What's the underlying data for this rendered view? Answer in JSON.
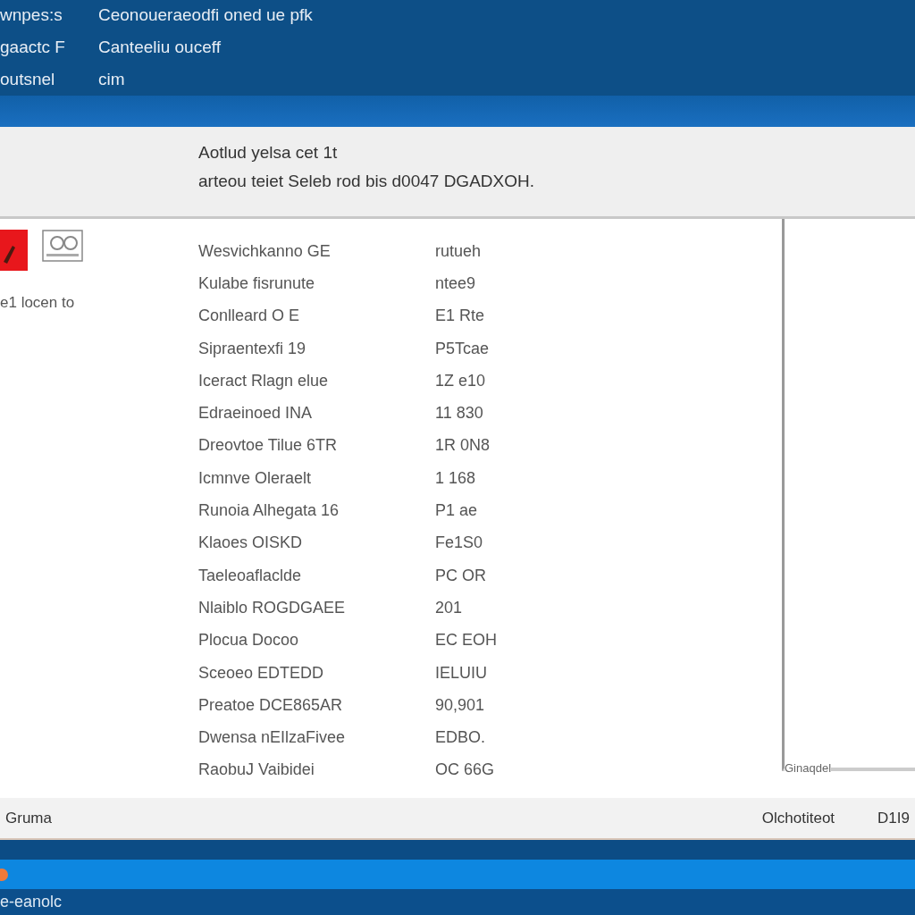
{
  "header": {
    "rows": [
      {
        "label": "wnpes:s",
        "value": "Ceonoueraeodfi oned ue pfk"
      },
      {
        "label": "gaactc F",
        "value": "Canteeliu ouceff"
      },
      {
        "label": "outsnel",
        "value": "cim"
      }
    ]
  },
  "info_panel": {
    "title": "Aotlud yelsa cet 1t",
    "text": "arteou teiet Seleb rod bis d0047 DGADXOH."
  },
  "sidebar": {
    "caption": "e1 locen to"
  },
  "list": {
    "rows": [
      {
        "name": "Wesvichkanno GE",
        "value": "rutueh"
      },
      {
        "name": "Kulabe fisrunute",
        "value": "ntee9"
      },
      {
        "name": "Conlleard O E",
        "value": "E1 Rte"
      },
      {
        "name": "Sipraentexfi 19",
        "value": "P5Tcae"
      },
      {
        "name": "Iceract Rlagn elue",
        "value": "1Z e10"
      },
      {
        "name": "Edraeinoed INA",
        "value": "11 830"
      },
      {
        "name": "Dreovtoe Tilue 6TR",
        "value": "1R 0N8"
      },
      {
        "name": "Icmnve Oleraelt",
        "value": "1 168"
      },
      {
        "name": "Runoia Alhegata 16",
        "value": "P1 ae"
      },
      {
        "name": "Klaoes OISKD",
        "value": "Fe1S0"
      },
      {
        "name": "Taeleoaflaclde",
        "value": "PC OR"
      },
      {
        "name": "Nlaiblo ROGDGAEE",
        "value": "201"
      },
      {
        "name": "Plocua Docoo",
        "value": "EC EOH"
      },
      {
        "name": "Sceoeo EDTEDD",
        "value": "IELUIU"
      },
      {
        "name": "Preatoe DCE865AR",
        "value": "90,901"
      },
      {
        "name": "Dwensa nEIlzaFivee",
        "value": "EDBO."
      },
      {
        "name": "RaobuJ Vaibidei",
        "value": "OC 66G"
      }
    ]
  },
  "side_panel": {
    "label": "Ginaqdel"
  },
  "status_bar": {
    "left": "Gruma",
    "right": "Olchotiteot",
    "code": "D1I9"
  },
  "taskbar": {
    "text": "e-eanolc"
  }
}
